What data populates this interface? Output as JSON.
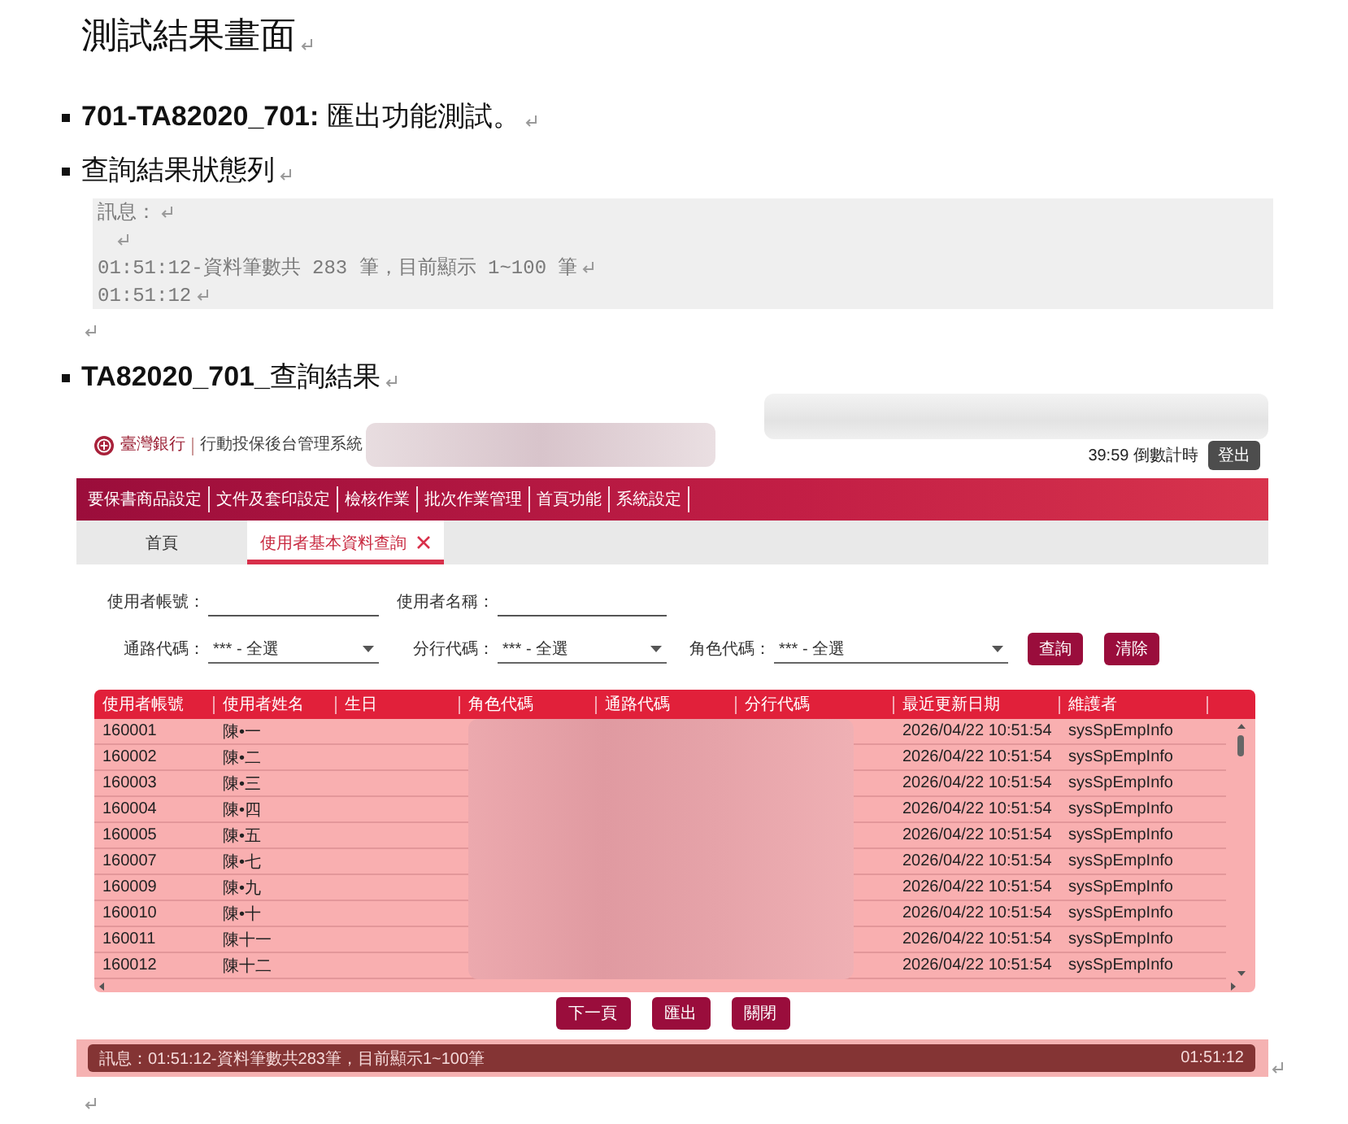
{
  "heading": "測試結果畫面",
  "show_paragraph_marks": true,
  "items": [
    {
      "kind": "bullet",
      "text": "**701-TA82020_701:** 匯出功能測試。"
    },
    {
      "kind": "bullet",
      "text": "查詢結果狀態列"
    },
    {
      "kind": "message_box",
      "lines": [
        {
          "kind": "text",
          "text": "訊息："
        },
        {
          "kind": "blank"
        },
        {
          "kind": "text",
          "text": "01:51:12-資料筆數共 283 筆，目前顯示 1~100 筆"
        },
        {
          "kind": "text",
          "text": "01:51:12"
        }
      ]
    },
    {
      "kind": "empty_paragraph"
    },
    {
      "kind": "bullet",
      "text": "**TA82020_701_**查詢結果"
    },
    {
      "kind": "screenshot",
      "app": {
        "header": {
          "redacted": true,
          "bank_name": "臺灣銀行",
          "system_name": "行動投保後台管理系統",
          "countdown": "39:59 倒數計時",
          "logout": "登出"
        },
        "menu": [
          "要保書商品設定",
          "文件及套印設定",
          "檢核作業",
          "批次作業管理",
          "首頁功能",
          "系統設定"
        ],
        "tabs": [
          {
            "label": "首頁",
            "selected": false,
            "closable": false
          },
          {
            "label": "使用者基本資料查詢",
            "selected": true,
            "closable": true
          }
        ],
        "form": {
          "rows": [
            [
              {
                "kind": "text",
                "label": "使用者帳號："
              },
              {
                "kind": "text",
                "label": "使用者名稱："
              }
            ],
            [
              {
                "kind": "select",
                "label": "通路代碼：",
                "value": "*** - 全選"
              },
              {
                "kind": "select",
                "label": "分行代碼：",
                "value": "*** - 全選"
              },
              {
                "kind": "select",
                "label": "角色代碼：",
                "value": "*** - 全選"
              }
            ]
          ],
          "buttons": [
            "查詢",
            "清除"
          ]
        },
        "table": {
          "redacted": true,
          "columns": [
            "使用者帳號",
            "使用者姓名",
            "生日",
            "角色代碼",
            "通路代碼",
            "分行代碼",
            "最近更新日期",
            "維護者"
          ],
          "rows": [
            [
              "160001",
              "陳•一",
              null,
              null,
              null,
              null,
              "2026/04/22 10:51:54",
              "sysSpEmpInfo"
            ],
            [
              "160002",
              "陳•二",
              null,
              null,
              null,
              null,
              "2026/04/22 10:51:54",
              "sysSpEmpInfo"
            ],
            [
              "160003",
              "陳•三",
              null,
              null,
              null,
              null,
              "2026/04/22 10:51:54",
              "sysSpEmpInfo"
            ],
            [
              "160004",
              "陳•四",
              null,
              null,
              null,
              null,
              "2026/04/22 10:51:54",
              "sysSpEmpInfo"
            ],
            [
              "160005",
              "陳•五",
              null,
              null,
              null,
              null,
              "2026/04/22 10:51:54",
              "sysSpEmpInfo"
            ],
            [
              "160007",
              "陳•七",
              null,
              null,
              null,
              null,
              "2026/04/22 10:51:54",
              "sysSpEmpInfo"
            ],
            [
              "160009",
              "陳•九",
              null,
              null,
              null,
              null,
              "2026/04/22 10:51:54",
              "sysSpEmpInfo"
            ],
            [
              "160010",
              "陳•十",
              null,
              null,
              null,
              null,
              "2026/04/22 10:51:54",
              "sysSpEmpInfo"
            ],
            [
              "160011",
              "陳十一",
              null,
              null,
              null,
              null,
              "2026/04/22 10:51:54",
              "sysSpEmpInfo"
            ],
            [
              "160012",
              "陳十二",
              null,
              null,
              null,
              null,
              "2026/04/22 10:51:54",
              "sysSpEmpInfo"
            ]
          ]
        },
        "buttons": [
          "下一頁",
          "匯出",
          "關閉"
        ],
        "status_bar": {
          "message": "訊息：01:51:12-資料筆數共283筆，目前顯示1~100筆",
          "time": "01:51:12"
        }
      }
    },
    {
      "kind": "empty_paragraph"
    }
  ]
}
